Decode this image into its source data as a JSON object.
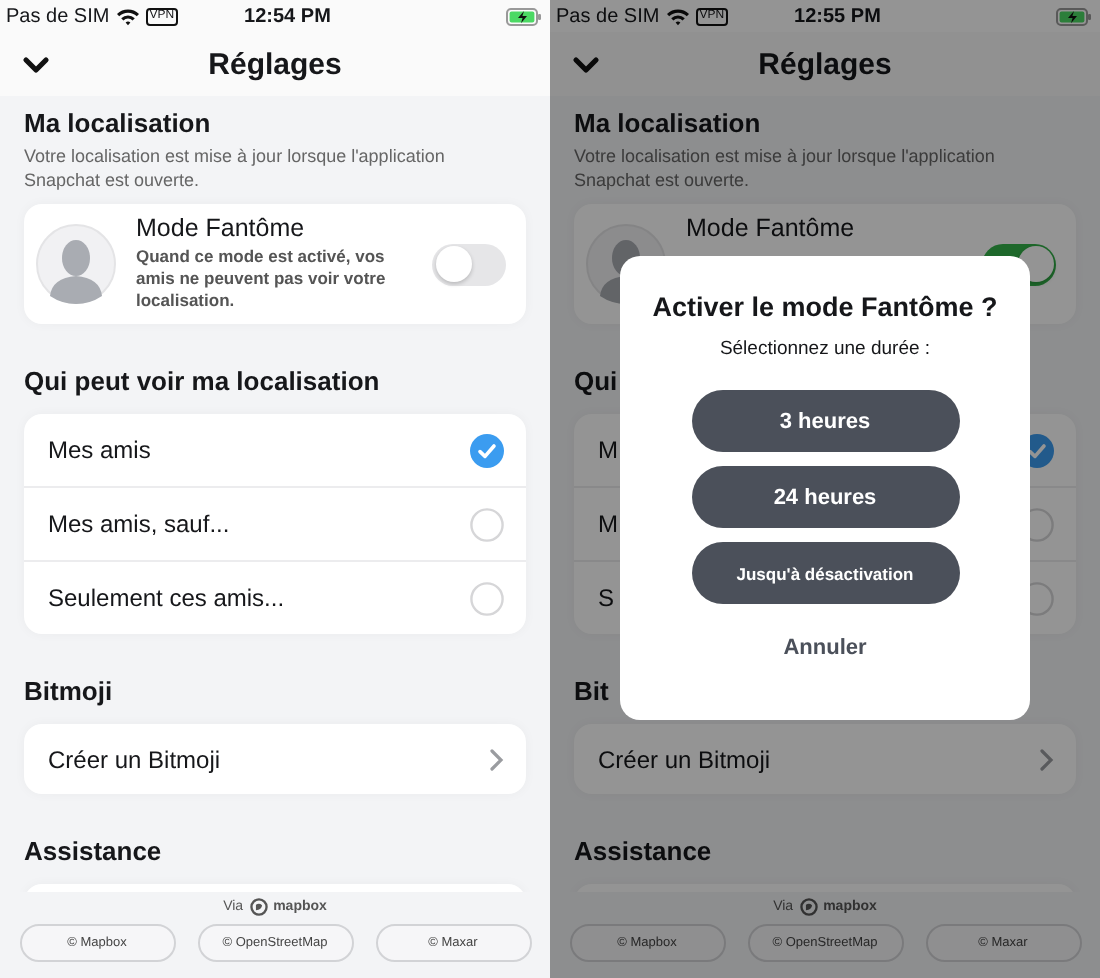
{
  "screens": [
    {
      "status": {
        "carrier": "Pas de SIM",
        "vpn": "VPN",
        "time": "12:54 PM"
      },
      "title": "Réglages",
      "dimmed": false,
      "sections": [
        {
          "kind": "toggle_card",
          "heading": "Ma localisation",
          "subtitle": "Votre localisation est mise à jour lorsque l'application Snapchat est ouverte.",
          "title": "Mode Fantôme",
          "description": "Quand ce mode est activé, vos amis ne peuvent pas voir votre localisation.",
          "on": false
        },
        {
          "kind": "radio_list",
          "heading": "Qui peut voir ma localisation",
          "items": [
            {
              "label": "Mes amis",
              "selected": true
            },
            {
              "label": "Mes amis, sauf...",
              "selected": false
            },
            {
              "label": "Seulement ces amis...",
              "selected": false
            }
          ]
        },
        {
          "kind": "link_list",
          "heading": "Bitmoji",
          "items": [
            {
              "label": "Créer un Bitmoji"
            }
          ]
        },
        {
          "kind": "link_list",
          "heading": "Assistance"
        }
      ],
      "footer": {
        "via": "Via",
        "brand": "mapbox",
        "credits": [
          "© Mapbox",
          "© OpenStreetMap",
          "© Maxar"
        ]
      }
    },
    {
      "status": {
        "carrier": "Pas de SIM",
        "vpn": "VPN",
        "time": "12:55 PM"
      },
      "title": "Réglages",
      "dimmed": true,
      "sections": [
        {
          "kind": "toggle_card",
          "heading": "Ma localisation",
          "subtitle": "Votre localisation est mise à jour lorsque l'application Snapchat est ouverte.",
          "title": "Mode Fantôme",
          "on": true
        },
        {
          "kind": "radio_list",
          "heading": "Qui",
          "items": [
            {
              "label": "M",
              "selected": true
            },
            {
              "label": "M",
              "selected": false
            },
            {
              "label": "S",
              "selected": false
            }
          ]
        },
        {
          "kind": "link_list",
          "heading": "Bit",
          "items": [
            {
              "label": "Créer un Bitmoji"
            }
          ]
        },
        {
          "kind": "link_list",
          "heading": "Assistance"
        }
      ],
      "footer": {
        "via": "Via",
        "brand": "mapbox",
        "credits": [
          "© Mapbox",
          "© OpenStreetMap",
          "© Maxar"
        ]
      },
      "dialog": {
        "title": "Activer le mode Fantôme ?",
        "subtitle": "Sélectionnez une durée :",
        "options": [
          "3 heures",
          "24 heures",
          "Jusqu'à désactivation"
        ],
        "cancel": "Annuler"
      }
    }
  ]
}
